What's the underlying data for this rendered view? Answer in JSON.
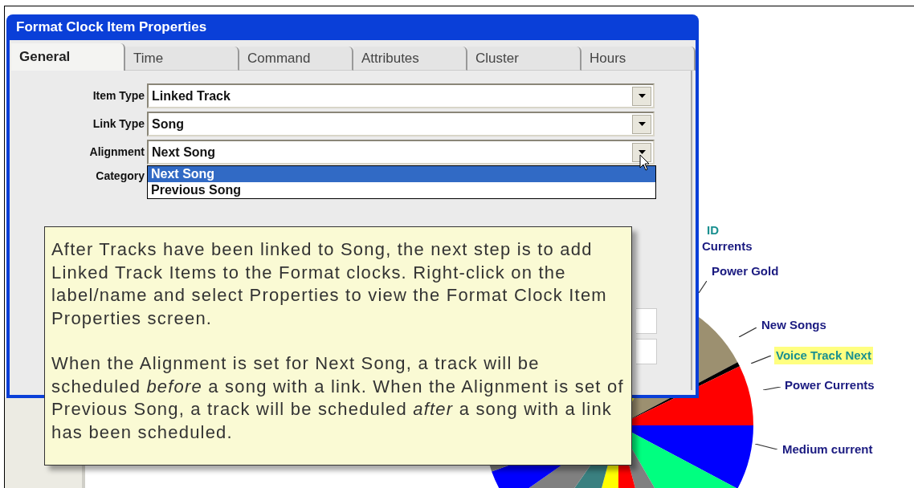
{
  "window": {
    "title": "Format Clock Item Properties"
  },
  "tabs": [
    {
      "label": "General",
      "selected": true
    },
    {
      "label": "Time",
      "selected": false
    },
    {
      "label": "Command",
      "selected": false
    },
    {
      "label": "Attributes",
      "selected": false
    },
    {
      "label": "Cluster",
      "selected": false
    },
    {
      "label": "Hours",
      "selected": false
    }
  ],
  "fields": [
    {
      "label": "Item Type",
      "value": "Linked Track",
      "expanded": false
    },
    {
      "label": "Link Type",
      "value": "Song",
      "expanded": false
    },
    {
      "label": "Alignment",
      "value": "Next Song",
      "expanded": true
    }
  ],
  "dropdown_options": [
    {
      "label": "Next Song",
      "selected": true
    },
    {
      "label": "Previous Song",
      "selected": false
    }
  ],
  "category_label": "Category",
  "tooltip": {
    "paragraphs": [
      "After Tracks have been linked to Song, the next step is to add Linked Track Items to the Format clocks. Right-click on the label/name and select Properties to view the Format Clock Item Properties screen.",
      "When the Alignment is set for Next Song, a track will be scheduled *before* a song with a link.  When the Alignment is set of Previous Song, a track will be scheduled *after* a song with a link has been scheduled."
    ]
  },
  "chart_labels": [
    {
      "text": "ID",
      "color": "#1a9090",
      "highlighted": false
    },
    {
      "text": "Currents",
      "color": "#1a1a80",
      "highlighted": false
    },
    {
      "text": "Power Gold",
      "color": "#1a1a80",
      "highlighted": false
    },
    {
      "text": "New Songs",
      "color": "#1a1a80",
      "highlighted": false
    },
    {
      "text": "Voice Track  Next",
      "color": "#1a9090",
      "highlighted": true
    },
    {
      "text": "Power Currents",
      "color": "#1a1a80",
      "highlighted": false
    },
    {
      "text": "Medium current",
      "color": "#1a1a80",
      "highlighted": false
    }
  ]
}
